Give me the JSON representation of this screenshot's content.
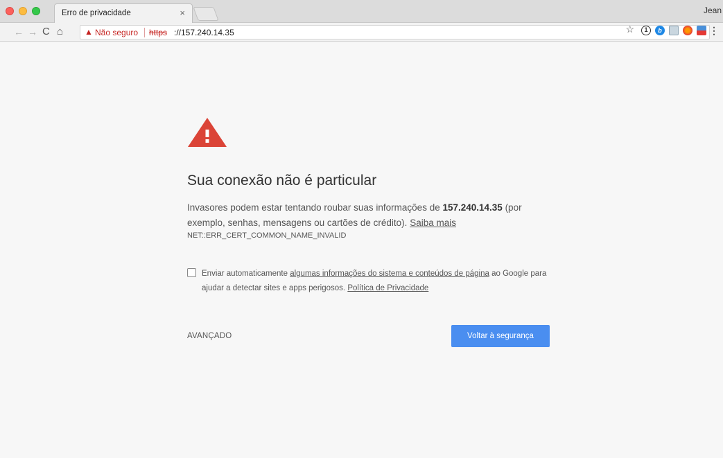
{
  "browser": {
    "tab_title": "Erro de privacidade",
    "tab_close": "×",
    "profile_name": "Jean",
    "nav": {
      "back": "←",
      "forward": "→",
      "reload": "C",
      "home": "⌂"
    },
    "address_bar": {
      "security_icon": "warning-triangle",
      "security_label": "Não seguro",
      "scheme": "https",
      "rest": "://157.240.14.35"
    },
    "toolbar_icons": [
      "bookmark-star-icon",
      "1password-icon",
      "extension-b-icon",
      "cast-icon",
      "extension-circle-icon",
      "extension-flag-icon",
      "menu-icon"
    ],
    "star": "☆",
    "ext1_text": "1",
    "ext2_text": "b",
    "menu": "⋮"
  },
  "page": {
    "heading": "Sua conexão não é particular",
    "para_prefix": "Invasores podem estar tentando roubar suas informações de ",
    "host_bold": "157.240.14.35",
    "para_suffix": " (por exemplo, senhas, mensagens ou cartões de crédito). ",
    "learn_more": "Saiba mais",
    "error_code": "NET::ERR_CERT_COMMON_NAME_INVALID",
    "optin_prefix": "Enviar automaticamente ",
    "optin_link": "algumas informações do sistema e conteúdos de página",
    "optin_middle": " ao Google para ajudar a detectar sites e apps perigosos. ",
    "privacy_link": "Política de Privacidade",
    "checkbox_checked": false,
    "advanced_label": "AVANÇADO",
    "back_to_safety_label": "Voltar à segurança"
  },
  "colors": {
    "warning_red": "#db4437",
    "primary_blue": "#4a8ef0",
    "page_bg": "#f7f7f7"
  }
}
